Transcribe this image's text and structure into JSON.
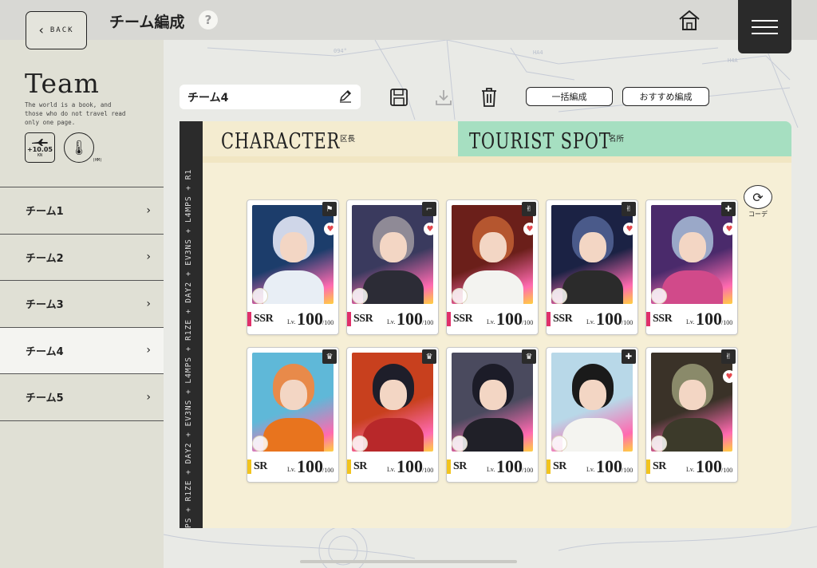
{
  "header": {
    "back_label": "BACK",
    "title": "チーム編成",
    "help_label": "?"
  },
  "sidebar": {
    "heading": "Team",
    "description": "The world is a book, and those who do not travel read only one page.",
    "stat_plane_value": "+10.05",
    "stat_plane_unit": "KN",
    "stat_temp_unit": "(HM)",
    "items": [
      {
        "label": "チーム1",
        "active": false
      },
      {
        "label": "チーム2",
        "active": false
      },
      {
        "label": "チーム3",
        "active": false
      },
      {
        "label": "チーム4",
        "active": true
      },
      {
        "label": "チーム5",
        "active": false
      }
    ]
  },
  "toolbar": {
    "team_name": "チーム4",
    "bulk_label": "一括編成",
    "recommend_label": "おすすめ編成"
  },
  "board": {
    "strip_text": "PS + R1ZE + DAY2 + EV3NS + L4MPS + R1ZE + DAY2 + EV3NS + L4MPS + R1",
    "character_tab": "CHARACTER",
    "character_sub": "区長",
    "tourist_tab": "TOURIST SPOT",
    "tourist_sub": "名所",
    "rotate_label": "コーデ"
  },
  "cards": [
    {
      "rarity": "SSR",
      "level": "100",
      "max": "100",
      "lv_label": "Lv.",
      "icon": "flag-icon",
      "glyph": "⚑",
      "heart": true,
      "hair": "#cfd6e8",
      "bg": "#1c3d6b",
      "body": "#e8eef5",
      "bar": "#e0306a"
    },
    {
      "rarity": "SSR",
      "level": "100",
      "max": "100",
      "lv_label": "Lv.",
      "icon": "gun-icon",
      "glyph": "⌐",
      "heart": true,
      "hair": "#8f8a96",
      "bg": "#3a3a5e",
      "body": "#2c2c36",
      "bar": "#e0306a"
    },
    {
      "rarity": "SSR",
      "level": "100",
      "max": "100",
      "lv_label": "Lv.",
      "icon": "hand-icon",
      "glyph": "✌",
      "heart": true,
      "hair": "#b5562f",
      "bg": "#6b1f1a",
      "body": "#f3f3f0",
      "bar": "#e0306a"
    },
    {
      "rarity": "SSR",
      "level": "100",
      "max": "100",
      "lv_label": "Lv.",
      "icon": "hand-icon",
      "glyph": "✌",
      "heart": true,
      "hair": "#4a5a8a",
      "bg": "#1b2244",
      "body": "#2b2b2b",
      "bar": "#e0306a"
    },
    {
      "rarity": "SSR",
      "level": "100",
      "max": "100",
      "lv_label": "Lv.",
      "icon": "medkit-icon",
      "glyph": "✚",
      "heart": true,
      "hair": "#9aa8c8",
      "bg": "#4a2a6b",
      "body": "#d14a8a",
      "bar": "#e0306a"
    },
    {
      "rarity": "SR",
      "level": "100",
      "max": "100",
      "lv_label": "Lv.",
      "icon": "jester-icon",
      "glyph": "♛",
      "heart": false,
      "hair": "#e88a4a",
      "bg": "#5fb8d8",
      "body": "#e8741e",
      "bar": "#f2c41e"
    },
    {
      "rarity": "SR",
      "level": "100",
      "max": "100",
      "lv_label": "Lv.",
      "icon": "jester-icon",
      "glyph": "♛",
      "heart": false,
      "hair": "#1e1e2a",
      "bg": "#c8401e",
      "body": "#b8282a",
      "bar": "#f2c41e"
    },
    {
      "rarity": "SR",
      "level": "100",
      "max": "100",
      "lv_label": "Lv.",
      "icon": "jester-icon",
      "glyph": "♛",
      "heart": false,
      "hair": "#1c1c28",
      "bg": "#4a4a5e",
      "body": "#202028",
      "bar": "#f2c41e"
    },
    {
      "rarity": "SR",
      "level": "100",
      "max": "100",
      "lv_label": "Lv.",
      "icon": "medkit-icon",
      "glyph": "✚",
      "heart": false,
      "hair": "#1a1a1a",
      "bg": "#b8d8e8",
      "body": "#f4f4f0",
      "bar": "#f2c41e"
    },
    {
      "rarity": "SR",
      "level": "100",
      "max": "100",
      "lv_label": "Lv.",
      "icon": "hand-icon",
      "glyph": "✌",
      "heart": true,
      "hair": "#8a8a6a",
      "bg": "#3a3228",
      "body": "#3c3a2a",
      "bar": "#f2c41e"
    }
  ]
}
